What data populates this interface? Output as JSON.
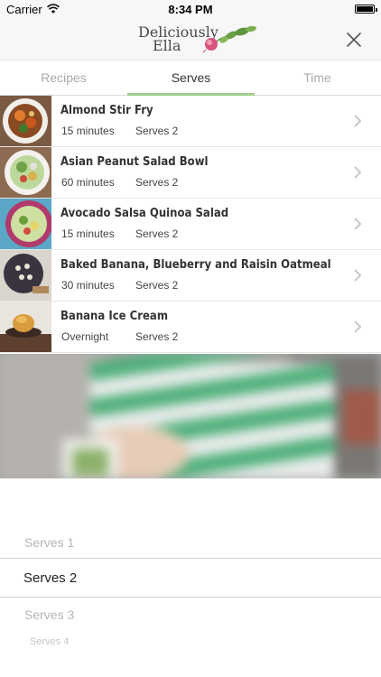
{
  "status_bar": {
    "carrier": "Carrier",
    "time": "8:34 PM"
  },
  "header": {
    "logo_line1": "Deliciously",
    "logo_line2": "Ella"
  },
  "tabs": [
    {
      "label": "Recipes",
      "active": false
    },
    {
      "label": "Serves",
      "active": true
    },
    {
      "label": "Time",
      "active": false
    }
  ],
  "recipes": [
    {
      "name": "Almond Stir Fry",
      "time": "15 minutes",
      "serves": "Serves 2"
    },
    {
      "name": "Asian Peanut Salad Bowl",
      "time": "60 minutes",
      "serves": "Serves 2"
    },
    {
      "name": "Avocado Salsa Quinoa Salad",
      "time": "15 minutes",
      "serves": "Serves 2"
    },
    {
      "name": "Baked Banana, Blueberry and Raisin Oatmeal",
      "time": "30 minutes",
      "serves": "Serves 2"
    },
    {
      "name": "Banana Ice Cream",
      "time": "Overnight",
      "serves": "Serves 2"
    }
  ],
  "picker": {
    "options": [
      "Serves 1",
      "Serves 2",
      "Serves 3",
      "Serves 4"
    ],
    "selected": "Serves 2"
  },
  "colors": {
    "accent": "#a3cf8c",
    "header_bg": "#f7f7f7"
  }
}
